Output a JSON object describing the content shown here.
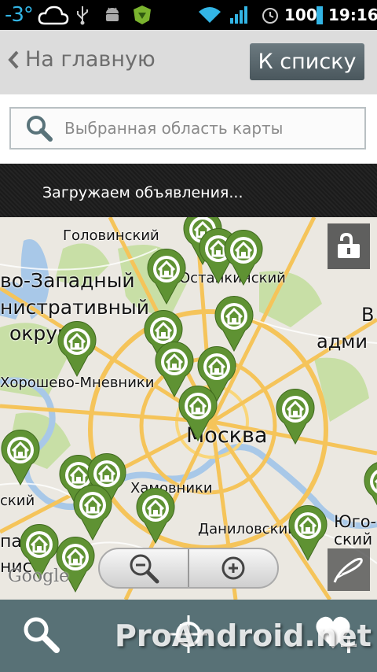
{
  "statusbar": {
    "temperature": "-3°",
    "battery": "100",
    "time": "19:16"
  },
  "header": {
    "back_label": "На главную",
    "list_button": "К списку"
  },
  "search": {
    "placeholder": "Выбранная область карты"
  },
  "loading": {
    "text": "Загружаем объявления..."
  },
  "map": {
    "labels": [
      "Головинский",
      "Останкинский",
      "во-Западный",
      "нистративный",
      "округ",
      "Хорошево-Мневники",
      "Москва",
      "Хамовники",
      "Даниловский",
      "Юго-",
      "ский",
      "пад",
      "нист",
      "В",
      "адми",
      "ский"
    ],
    "google_logo": "Google"
  },
  "watermark": "ProAndroid.net",
  "colors": {
    "pin": "#5f9233",
    "header": "#dcdcdc",
    "bottombar": "#587176",
    "accent": "#33b5e5"
  }
}
